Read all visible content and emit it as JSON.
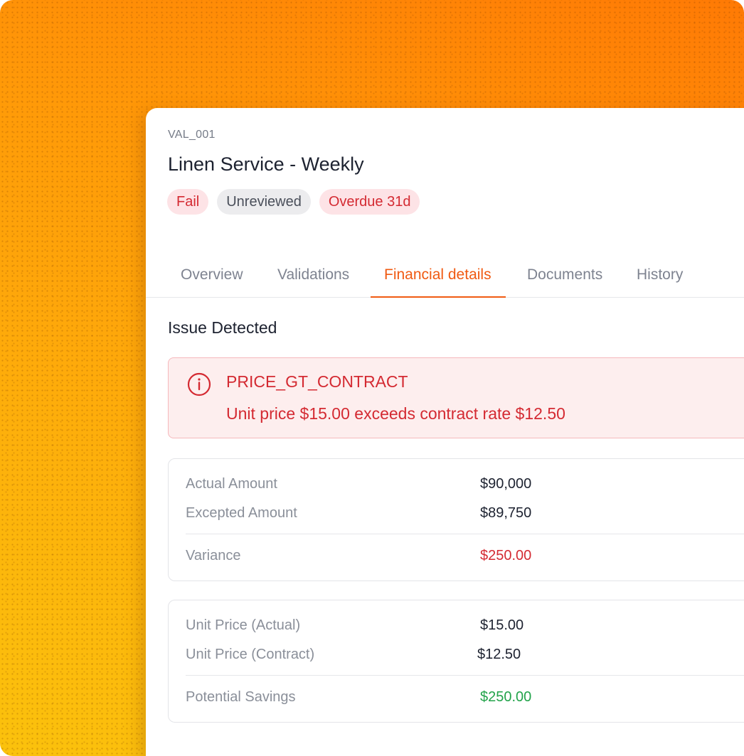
{
  "record": {
    "id": "VAL_001",
    "title": "Linen Service - Weekly",
    "badges": {
      "fail": "Fail",
      "review": "Unreviewed",
      "overdue": "Overdue 31d"
    }
  },
  "tabs": [
    {
      "label": "Overview",
      "active": false
    },
    {
      "label": "Validations",
      "active": false
    },
    {
      "label": "Financial details",
      "active": true
    },
    {
      "label": "Documents",
      "active": false
    },
    {
      "label": "History",
      "active": false
    }
  ],
  "issue": {
    "section_title": "Issue Detected",
    "icon": "info-circle-icon",
    "code": "PRICE_GT_CONTRACT",
    "message": "Unit price $15.00 exceeds contract rate $12.50"
  },
  "amounts": {
    "actual_label": "Actual Amount",
    "actual_value": "$90,000",
    "expected_label": "Excepted Amount",
    "expected_value": "$89,750",
    "variance_label": "Variance",
    "variance_value": "$250.00"
  },
  "pricing": {
    "actual_label": "Unit Price (Actual)",
    "actual_value": "$15.00",
    "contract_label": "Unit Price (Contract)",
    "contract_value": "$12.50",
    "savings_label": "Potential Savings",
    "savings_value": "$250.00"
  },
  "colors": {
    "accent": "#f05a12",
    "error": "#d42a32",
    "success": "#22a34a"
  }
}
